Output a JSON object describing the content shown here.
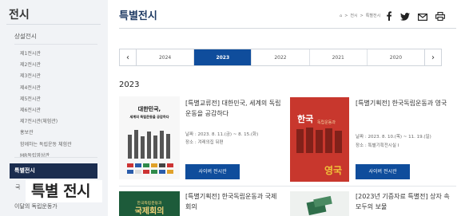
{
  "sidebar": {
    "title": "전시",
    "sub_heading": "상설전시",
    "items": [
      "제1전시관",
      "제2전시관",
      "제3전시관",
      "제4전시관",
      "제5전시관",
      "제6전시관",
      "제7전시관(체험관)",
      "홍보관",
      "함께하는 독립운동 체험관",
      "MR독립영상관"
    ],
    "active": "특별전시",
    "item_after": "국",
    "item_last": "이달의 독립운동가"
  },
  "caption": "특별 전시",
  "header": {
    "title": "특별전시",
    "breadcrumb": [
      "⌂",
      ">",
      "전시",
      ">",
      "특별전시"
    ],
    "share_icons": [
      "facebook-icon",
      "twitter-icon",
      "mail-icon",
      "print-icon"
    ]
  },
  "year_nav": {
    "years": [
      "2024",
      "2023",
      "2022",
      "2021",
      "2020"
    ],
    "active": "2023",
    "prev": "‹",
    "next": "›"
  },
  "year_heading": "2023",
  "cards": [
    {
      "title": "[특별교류전] 대한민국, 세계의 독립운동을 공감하다",
      "date": "날짜 : 2023. 8. 11.(금) ~ 8. 15.(화)",
      "place": "장소 : 겨레의집 뒤편",
      "button": "사이버 전시관",
      "poster_title": "대한민국,",
      "poster_sub": "세계의 독립운동을 공감하다"
    },
    {
      "title": "[특별기획전] 한국독립운동과 영국",
      "date": "날짜 : 2023. 8. 10.(목) ~ 11. 19.(일)",
      "place": "장소 : 특별기획전시실 Ⅰ",
      "button": "사이버 전시관",
      "poster_top": "한국",
      "poster_mid": "독립운동과",
      "poster_bottom": "영국"
    },
    {
      "title": "[특별기획전] 한국독립운동과 국제회의",
      "poster_sub": "한국독립운동과",
      "poster_title": "국제회의"
    },
    {
      "title": "[2023년 기증자료 특별전] 상자 속 모두의 보물"
    }
  ],
  "colors": {
    "primary": "#0f4d9c",
    "navy": "#1b2d4f",
    "sidebar_bg": "#f1f3f6",
    "poster_red": "#c8372d",
    "poster_green": "#1d5b3a"
  }
}
